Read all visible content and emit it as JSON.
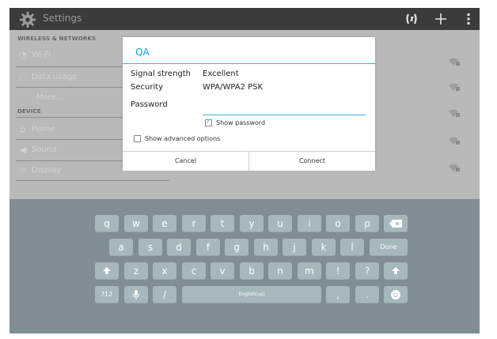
{
  "actionbar": {
    "title": "Settings"
  },
  "settings": {
    "sections": [
      "WIRELESS & NETWORKS",
      "DEVICE"
    ],
    "items": [
      {
        "label": "Wi-Fi"
      },
      {
        "label": "Data usage"
      },
      {
        "label": "More..."
      },
      {
        "label": "Home"
      },
      {
        "label": "Sound"
      },
      {
        "label": "Display"
      }
    ]
  },
  "dialog": {
    "title": "QA",
    "signal_label": "Signal strength",
    "signal_value": "Excellent",
    "security_label": "Security",
    "security_value": "WPA/WPA2 PSK",
    "password_label": "Password",
    "password_value": "",
    "show_password_label": "Show password",
    "show_password_checked": true,
    "advanced_label": "Show advanced options",
    "advanced_checked": false,
    "cancel_label": "Cancel",
    "connect_label": "Connect"
  },
  "keyboard": {
    "row1": [
      "q",
      "w",
      "e",
      "r",
      "t",
      "y",
      "u",
      "i",
      "o",
      "p"
    ],
    "row2": [
      "a",
      "s",
      "d",
      "f",
      "g",
      "h",
      "j",
      "k",
      "l"
    ],
    "done_label": "Done",
    "row3": [
      "z",
      "x",
      "c",
      "v",
      "b",
      "n",
      "m",
      "!",
      "?"
    ],
    "symbols_label": "?12",
    "slash_label": "/",
    "space_label": "English(us)",
    "comma_label": ",",
    "period_label": "."
  },
  "colors": {
    "actionbar": "#3b3b3b",
    "accent": "#33b5e5",
    "keyboard_bg": "#7f8e94",
    "key": "#a6b7bd",
    "dim_bg": "#b9b9b9"
  }
}
